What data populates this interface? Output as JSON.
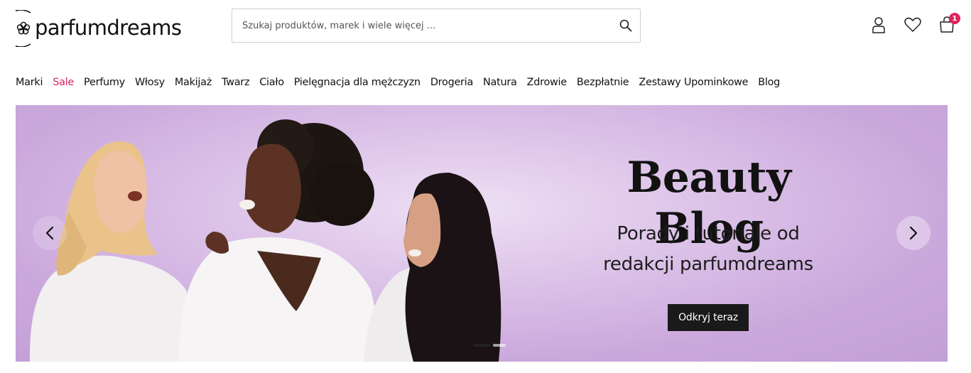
{
  "header": {
    "logo_text": "parfumdreams",
    "search": {
      "placeholder": "Szukaj produktów, marek i wiele więcej ...",
      "value": ""
    },
    "icons": [
      "search-icon",
      "user-icon",
      "heart-icon",
      "cart-icon"
    ],
    "cart_count": "1",
    "badge_color": "#e0245e"
  },
  "nav": {
    "items": [
      {
        "label": "Marki"
      },
      {
        "label": "Sale"
      },
      {
        "label": "Perfumy"
      },
      {
        "label": "Włosy"
      },
      {
        "label": "Makijaż"
      },
      {
        "label": "Twarz"
      },
      {
        "label": "Ciało"
      },
      {
        "label": "Pielęgnacja dla mężczyzn"
      },
      {
        "label": "Drogeria"
      },
      {
        "label": "Natura"
      },
      {
        "label": "Zdrowie"
      },
      {
        "label": "Bezpłatnie"
      },
      {
        "label": "Zestawy Upominkowe"
      },
      {
        "label": "Blog"
      }
    ],
    "sale_color": "#d6245f"
  },
  "hero": {
    "title": "Beauty Blog",
    "subtitle_line1": "Porady i tutoriale od",
    "subtitle_line2": "redakcji parfumdreams",
    "cta_label": "Odkryj teraz",
    "background_color": "#d4b6e2",
    "slides": {
      "count": 3,
      "active": 1
    }
  }
}
